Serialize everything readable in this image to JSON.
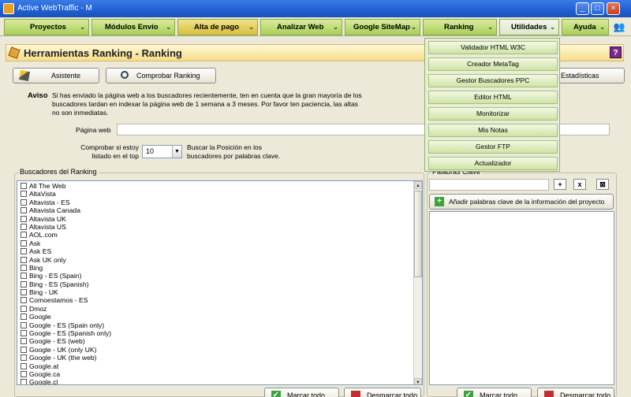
{
  "window": {
    "title": "Active WebTraffic - M",
    "minimize": "_",
    "maximize": "□",
    "close": "×"
  },
  "menu": [
    {
      "label": "Proyectos",
      "arrow": "⌄"
    },
    {
      "label": "Módulos Envío",
      "arrow": "⌄"
    },
    {
      "label": "Alta de pago",
      "arrow": "⌄"
    },
    {
      "label": "Analizar Web",
      "arrow": "⌄"
    },
    {
      "label": "Google SiteMap",
      "arrow": "⌄"
    },
    {
      "label": "Ranking",
      "arrow": "⌄"
    },
    {
      "label": "Utilidades",
      "arrow": "⌄"
    },
    {
      "label": "Ayuda",
      "arrow": "⌄"
    }
  ],
  "utilidades_menu": [
    "Validador HTML W3C",
    "Creador MetaTag",
    "Gestor Buscadores PPC",
    "Editor HTML",
    "Monitorizar",
    "Mis Notas",
    "Gestor FTP",
    "Actualizador"
  ],
  "header": {
    "title": "Herramientas Ranking -  Ranking",
    "help": "?"
  },
  "toolbar": {
    "asistente": "Asistente",
    "comprobar": "Comprobar Ranking",
    "estadisticas": "Estadísticas"
  },
  "aviso": {
    "label": "Aviso",
    "text": "Si has enviado la página web a los buscadores recientemente, ten en cuenta que la gran mayoría de los buscadores tardan en indexar la página web de 1 semana a 3 meses. Por favor ten paciencia, las altas no son inmediatas."
  },
  "form": {
    "pagina_label": "Página web",
    "pagina_value": "",
    "top_label": "Comprobar si estoy listado en el top",
    "top_value": "10",
    "top_hint": "Buscar la Posición en los buscadores por palabras clave."
  },
  "buscadores": {
    "title": "Buscadores del Ranking",
    "items": [
      "All The Web",
      "AltaVista",
      "Altavista - ES",
      "Altavista Canada",
      "Altavista UK",
      "Altavista US",
      "AOL.com",
      "Ask",
      "Ask ES",
      "Ask UK only",
      "Bing",
      "Bing - ES (Spain)",
      "Bing - ES (Spanish)",
      "Bing - UK",
      "Comoestamos - ES",
      "Dmoz",
      "Google",
      "Google - ES (Spain only)",
      "Google - ES (Spanish only)",
      "Google - ES (web)",
      "Google - UK (only UK)",
      "Google - UK (the web)",
      "Google.at",
      "Google.ca",
      "Google.cl"
    ],
    "marcar": "Marcar todo",
    "desmarcar": "Desmarcar todo"
  },
  "palabras": {
    "title": "Palabras Clave",
    "input_value": "",
    "add_from_project": "Añadir palabras clave de la información del proyecto",
    "add_btn": "+",
    "remove_btn": "x",
    "clear_btn": "⊠",
    "marcar": "Marcar todo",
    "desmarcar": "Desmarcar todo"
  }
}
